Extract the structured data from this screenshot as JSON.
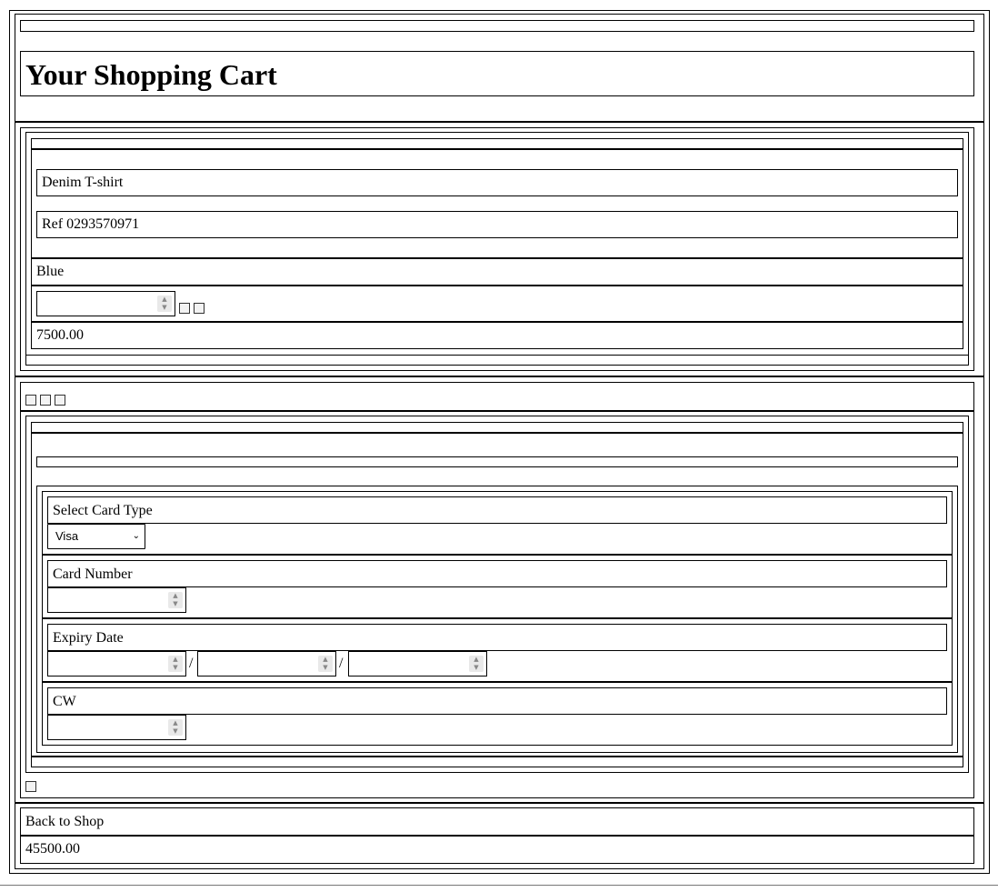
{
  "header": {
    "title": "Your Shopping Cart"
  },
  "cart": {
    "items": [
      {
        "name": "Denim T-shirt",
        "ref": "Ref 0293570971",
        "color": "Blue",
        "quantity": "",
        "price": "7500.00"
      }
    ]
  },
  "payment": {
    "card_type_label": "Select Card Type",
    "card_type_value": "Visa",
    "card_number_label": "Card Number",
    "card_number_value": "",
    "expiry_label": "Expiry Date",
    "expiry_separator": "/",
    "expiry_values": [
      "",
      "",
      ""
    ],
    "cvv_label": "CW",
    "cvv_value": ""
  },
  "footer": {
    "back_link": "Back to Shop",
    "total": "45500.00"
  },
  "icons": {
    "spinner": "spin-arrows-icon",
    "dropdown": "chevron-down-icon"
  }
}
